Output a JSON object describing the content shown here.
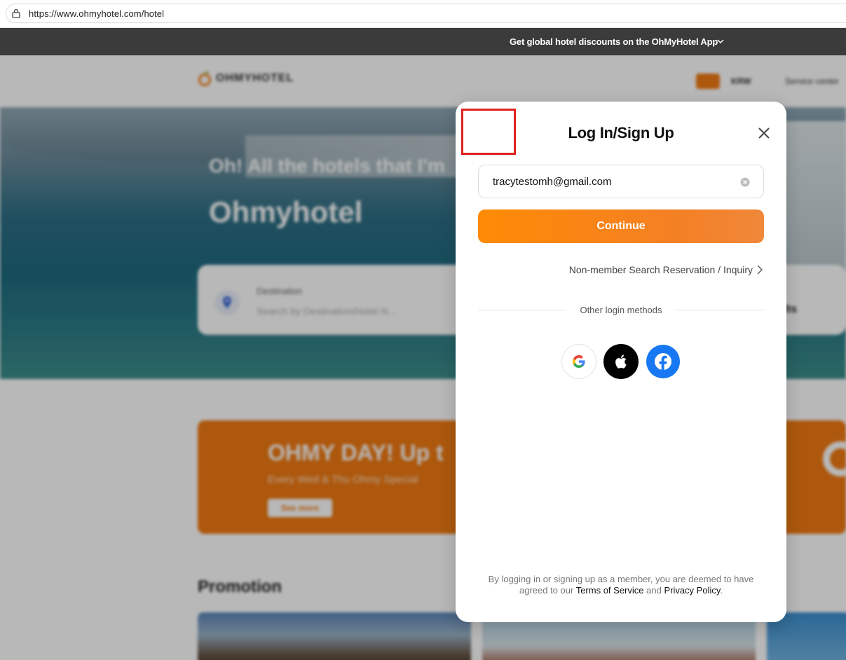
{
  "browser": {
    "url": "https://www.ohmyhotel.com/hotel"
  },
  "topbar": {
    "text": "Get global hotel discounts on the OhMyHotel App"
  },
  "background": {
    "logo_text": "OHMYHOTEL",
    "currency": "KRW",
    "service_center": "Service center",
    "hero_line1": "Oh! All the hotels that I'm",
    "hero_line2": "Ohmyhotel",
    "search": {
      "destination_label": "Destination",
      "destination_placeholder": "Search by Destination/Hotel N..."
    },
    "guests_partial": "adults",
    "banner": {
      "title": "OHMY DAY! Up t",
      "subtitle": "Every Wed & Thu Ohmy Special",
      "button": "See more"
    },
    "promotion_title": "Promotion"
  },
  "modal": {
    "title": "Log In/Sign Up",
    "email_value": "tracytestomh@gmail.com",
    "continue_label": "Continue",
    "nonmember_link": "Non-member Search Reservation / Inquiry",
    "divider_text": "Other login methods",
    "social": [
      {
        "name": "Google"
      },
      {
        "name": "Apple"
      },
      {
        "name": "Facebook"
      }
    ],
    "disclaimer_prefix": "By logging in or signing up as a member, you are deemed to have agreed to our ",
    "terms_link": "Terms of Service",
    "and_text": " and ",
    "privacy_link": "Privacy Policy",
    "period": ".",
    "colors": {
      "accent": "#ff8a05",
      "apple": "#000000",
      "facebook": "#1877f2",
      "highlight_box": "#e0201f"
    }
  }
}
